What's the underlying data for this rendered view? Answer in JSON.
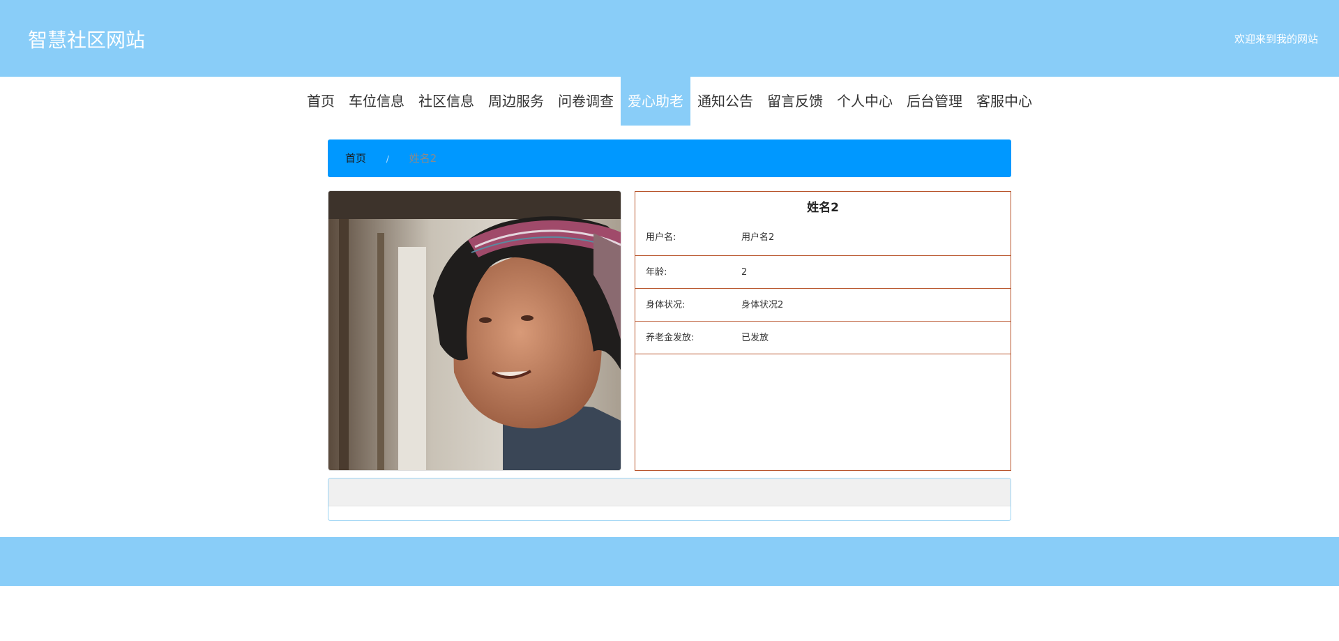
{
  "header": {
    "site_title": "智慧社区网站",
    "welcome": "欢迎来到我的网站"
  },
  "nav": {
    "items": [
      {
        "label": "首页"
      },
      {
        "label": "车位信息"
      },
      {
        "label": "社区信息"
      },
      {
        "label": "周边服务"
      },
      {
        "label": "问卷调查"
      },
      {
        "label": "爱心助老",
        "active": true
      },
      {
        "label": "通知公告"
      },
      {
        "label": "留言反馈"
      },
      {
        "label": "个人中心"
      },
      {
        "label": "后台管理"
      },
      {
        "label": "客服中心"
      }
    ]
  },
  "breadcrumb": {
    "home": "首页",
    "separator": "/",
    "current": "姓名2"
  },
  "detail": {
    "name": "姓名2",
    "rows": [
      {
        "label": "用户名:",
        "value": "用户名2"
      },
      {
        "label": "年龄:",
        "value": "2"
      },
      {
        "label": "身体状况:",
        "value": "身体状况2"
      },
      {
        "label": "养老金发放:",
        "value": "已发放"
      }
    ]
  },
  "colors": {
    "header_bg": "#89cdf8",
    "breadcrumb_bg": "#0098ff",
    "detail_border": "#b8542b"
  }
}
